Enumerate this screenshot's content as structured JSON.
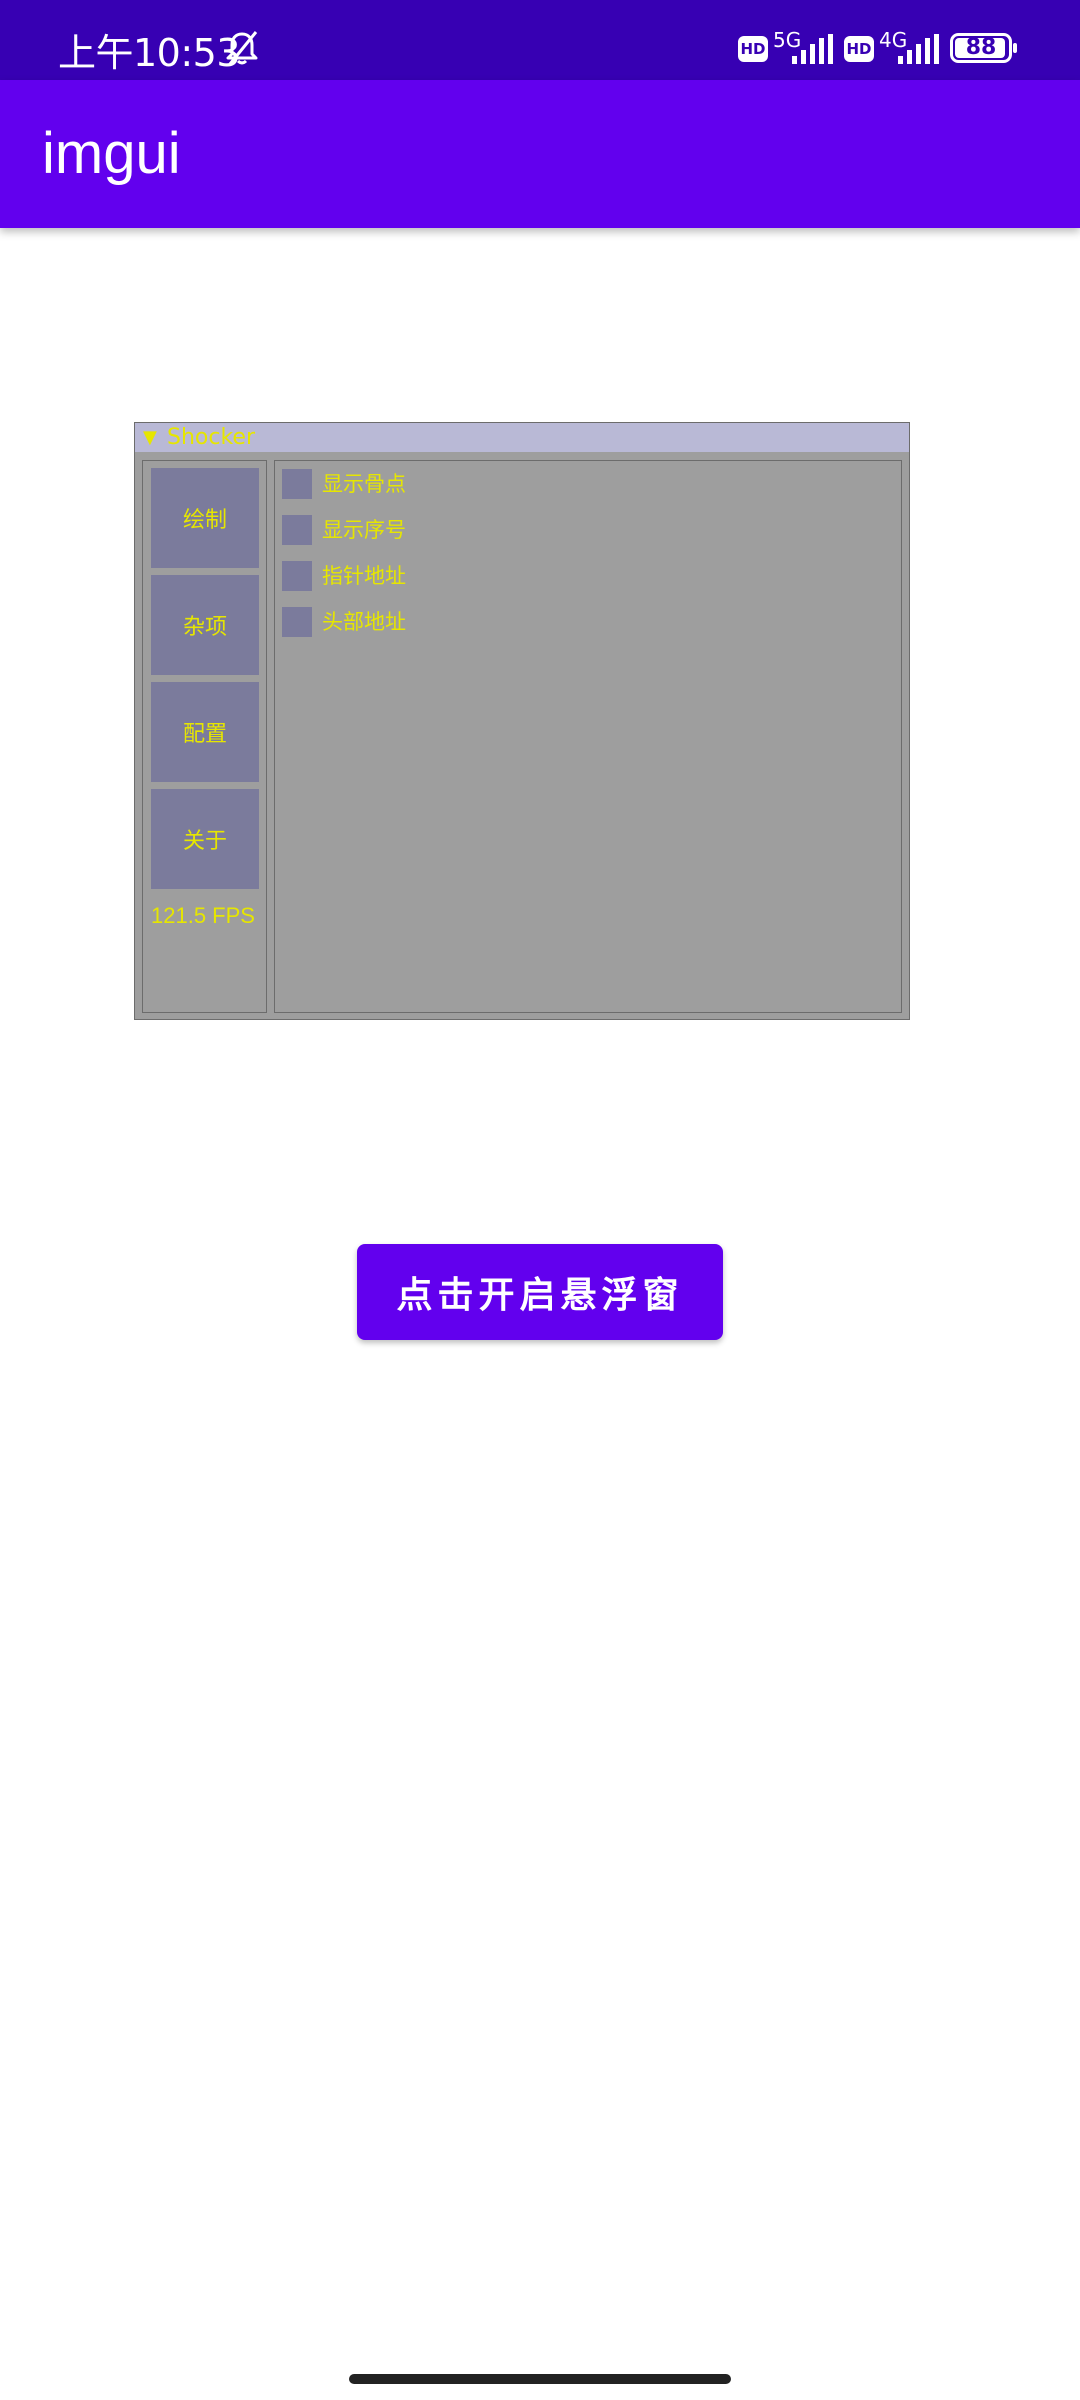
{
  "status_bar": {
    "time": "上午10:53",
    "hd_badge": "HD",
    "network_1": "5G",
    "network_2": "4G",
    "battery": "88"
  },
  "app_bar": {
    "title": "imgui"
  },
  "imgui_window": {
    "title": "Shocker",
    "nav_buttons": [
      "绘制",
      "杂项",
      "配置",
      "关于"
    ],
    "fps": "121.5 FPS",
    "checkboxes": [
      {
        "label": "显示骨点",
        "checked": false
      },
      {
        "label": "显示序号",
        "checked": false
      },
      {
        "label": "指针地址",
        "checked": false
      },
      {
        "label": "头部地址",
        "checked": false
      }
    ]
  },
  "main": {
    "button_label": "点击开启悬浮窗"
  },
  "colors": {
    "status_bar": "#3700b3",
    "primary": "#6200ee",
    "imgui_bg": "#9e9e9e",
    "imgui_title": "#b9b9d6",
    "imgui_button": "#7b7b9c",
    "imgui_text": "#e6e600"
  }
}
